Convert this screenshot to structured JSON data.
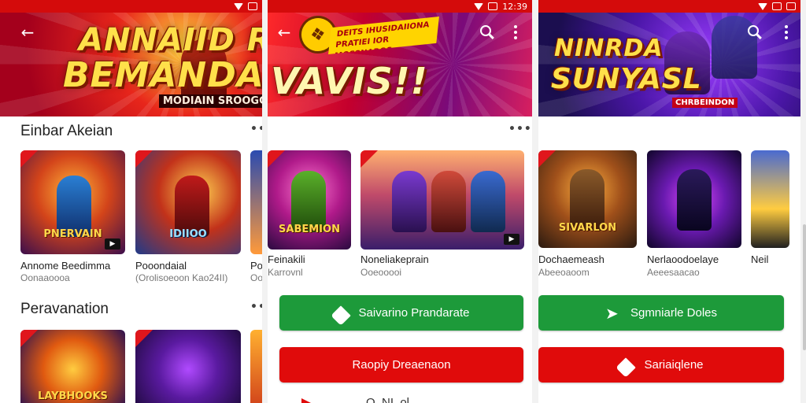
{
  "colors": {
    "accent_red": "#e00b0b",
    "status_red": "#d40b0b",
    "green": "#1d9a3a"
  },
  "status_bar": {
    "time": "12:39"
  },
  "screen1": {
    "banner_line1": "ANNAIID R&",
    "banner_line2": "BEMANDAL",
    "banner_sub": "MODIAIN SROOGGIBA",
    "sections": [
      {
        "title": "Einbar Akeian",
        "items": [
          {
            "art_text": "PNERVAIN",
            "title": "Annome Beedimma",
            "sub": "Oonaaoooa"
          },
          {
            "art_text": "IDIIOO",
            "title": "Pooondaial",
            "sub": "(Orolisoeoon Kao24II)"
          },
          {
            "art_text": "",
            "title": "Po",
            "sub": "Oo"
          }
        ]
      },
      {
        "title": "Peravanation",
        "items": [
          {
            "art_text": "LAYBHOOKS"
          },
          {
            "art_text": ""
          },
          {
            "art_text": ""
          }
        ]
      }
    ]
  },
  "screen2": {
    "banner_ribbon": "DEITS IHUSIDAIIONA PRATIEI IOR MOSSNAROS",
    "banner_title": "VAVIS!!",
    "items": [
      {
        "art_text": "SABEMION",
        "title": "Feinakili",
        "sub": "Karrovnl"
      },
      {
        "art_text": "",
        "title": "Noneliakeprain",
        "sub": "Ooeooooi"
      }
    ],
    "buttons": {
      "primary": "Saivarino Prandarate",
      "secondary": "Raopiy Dreaenaon",
      "third": "O. NI. ol."
    }
  },
  "screen3": {
    "banner_line1": "NINRDA",
    "banner_line2": "SUNYASL",
    "banner_sub": "CHRBEINDON",
    "items": [
      {
        "art_text": "SIVARLON",
        "title": "Dochaemeash",
        "sub": "Abeeoaoom"
      },
      {
        "art_text": "",
        "title": "Nerlaoodoelaye",
        "sub": "Aeeesaacao"
      },
      {
        "art_text": "",
        "title": "Neil",
        "sub": ""
      }
    ],
    "buttons": {
      "primary": "Sgmniarle Doles",
      "secondary": "Sariaiqlene"
    }
  }
}
